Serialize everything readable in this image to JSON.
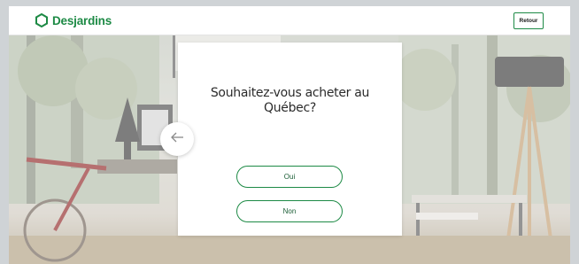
{
  "header": {
    "logo_text": "Desjardins",
    "logo_icon": "hexagon-logo-icon",
    "back_label": "Retour",
    "brand_color": "#1d8a45"
  },
  "modal": {
    "question": "Souhaitez-vous acheter au Québec?",
    "options": [
      {
        "label": "Oui"
      },
      {
        "label": "Non"
      }
    ],
    "previous_icon": "arrow-left-icon"
  }
}
